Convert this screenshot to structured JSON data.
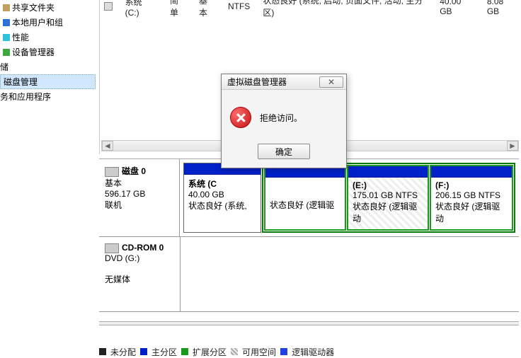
{
  "tree": {
    "items": [
      {
        "label": "共享文件夹",
        "icon": "i-tan"
      },
      {
        "label": "本地用户和组",
        "icon": "i-blue"
      },
      {
        "label": "性能",
        "icon": "i-cyan"
      },
      {
        "label": "设备管理器",
        "icon": "i-green"
      },
      {
        "label": "储",
        "icon": ""
      },
      {
        "label": "磁盘管理",
        "icon": "",
        "selected": true
      },
      {
        "label": "务和应用程序",
        "icon": ""
      }
    ]
  },
  "volumes": {
    "row": {
      "name": "系统 (C:)",
      "layout": "简单",
      "type": "基本",
      "fs": "NTFS",
      "status": "状态良好 (系统, 启动, 页面文件, 活动, 主分区)",
      "cap": "40.00 GB",
      "free": "8.08 GB"
    }
  },
  "disks": {
    "d0": {
      "title": "磁盘 0",
      "type": "基本",
      "size": "596.17 GB",
      "state": "联机",
      "parts": [
        {
          "name": "系统  (C",
          "size": "40.00 GB",
          "status": "状态良好 (系统, "
        },
        {
          "name": "",
          "size": "",
          "status": "状态良好 (逻辑驱"
        },
        {
          "name": "(E:)",
          "size": "175.01 GB NTFS",
          "status": "状态良好 (逻辑驱动"
        },
        {
          "name": "(F:)",
          "size": "206.15 GB NTFS",
          "status": "状态良好 (逻辑驱动"
        }
      ]
    },
    "cd": {
      "title": "CD-ROM 0",
      "type": "DVD (G:)",
      "state": "无媒体"
    }
  },
  "legend": {
    "l1": "未分配",
    "l2": "主分区",
    "l3": "扩展分区",
    "l4": "可用空间",
    "l5": "逻辑驱动器"
  },
  "dialog": {
    "title": "虚拟磁盘管理器",
    "msg": "拒绝访问。",
    "ok": "确定"
  }
}
